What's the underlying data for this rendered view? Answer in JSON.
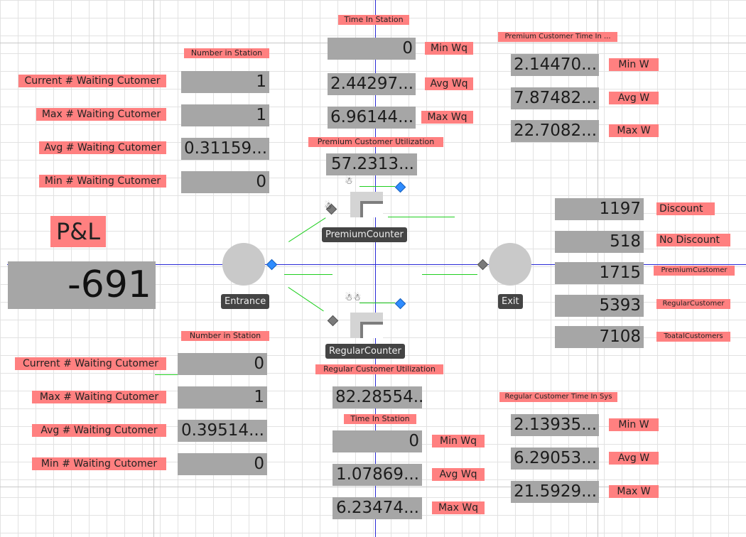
{
  "pl": {
    "label": "P&L",
    "value": "-691"
  },
  "premium": {
    "number_in_station_title": "Number in Station",
    "current_waiting_label": "Current # Waiting Cutomer",
    "current_waiting_value": "1",
    "max_waiting_label": "Max # Waiting Cutomer",
    "max_waiting_value": "1",
    "avg_waiting_label": "Avg # Waiting Cutomer",
    "avg_waiting_value": "0.31159...",
    "min_waiting_label": "Min # Waiting Cutomer",
    "min_waiting_value": "0",
    "time_in_station_title": "Time In Station",
    "min_wq_value": "0",
    "min_wq_label": "Min Wq",
    "avg_wq_value": "2.44297...",
    "avg_wq_label": "Avg Wq",
    "max_wq_value": "6.96144...",
    "max_wq_label": "Max Wq",
    "utilization_title": "Premium Customer Utilization",
    "utilization_value": "57.2313...",
    "time_in_sys_title": "Premium Customer Time In ...",
    "min_w_value": "2.14470...",
    "min_w_label": "Min W",
    "avg_w_value": "7.87482...",
    "avg_w_label": "Avg W",
    "max_w_value": "22.7082...",
    "max_w_label": "Max W"
  },
  "regular": {
    "number_in_station_title": "Number in Station",
    "current_waiting_label": "Current # Waiting Cutomer",
    "current_waiting_value": "0",
    "max_waiting_label": "Max # Waiting Cutomer",
    "max_waiting_value": "1",
    "avg_waiting_label": "Avg # Waiting Cutomer",
    "avg_waiting_value": "0.39514...",
    "min_waiting_label": "Min # Waiting Cutomer",
    "min_waiting_value": "0",
    "utilization_title": "Regular Customer Utilization",
    "utilization_value": "82.28554...",
    "time_in_station_title": "Time In Station",
    "min_wq_value": "0",
    "min_wq_label": "Min Wq",
    "avg_wq_value": "1.07869...",
    "avg_wq_label": "Avg Wq",
    "max_wq_value": "6.23474...",
    "max_wq_label": "Max Wq",
    "time_in_sys_title": "Regular Customer Time In Sys",
    "min_w_value": "2.13935...",
    "min_w_label": "Min W",
    "avg_w_value": "6.29053...",
    "avg_w_label": "Avg W",
    "max_w_value": "21.5929...",
    "max_w_label": "Max W"
  },
  "counts": {
    "discount_value": "1197",
    "discount_label": "Discount",
    "no_discount_value": "518",
    "no_discount_label": "No Discount",
    "premium_value": "1715",
    "premium_label": "PremiumCustomer",
    "regular_value": "5393",
    "regular_label": "RegularCustomer",
    "total_value": "7108",
    "total_label": "ToatalCustomers"
  },
  "nodes": {
    "entrance": "Entrance",
    "exit": "Exit",
    "premium_counter": "PremiumCounter",
    "regular_counter": "RegularCounter"
  },
  "icons": {
    "queue": "people-queue-icon",
    "port_in": "input-port-icon",
    "port_out": "output-port-icon"
  },
  "colors": {
    "label_bg": "#ff8080",
    "value_bg": "#a6a6a6",
    "axis": "#2a2ad6",
    "link": "#1fcf1f",
    "port_blue": "#2f8cff"
  }
}
